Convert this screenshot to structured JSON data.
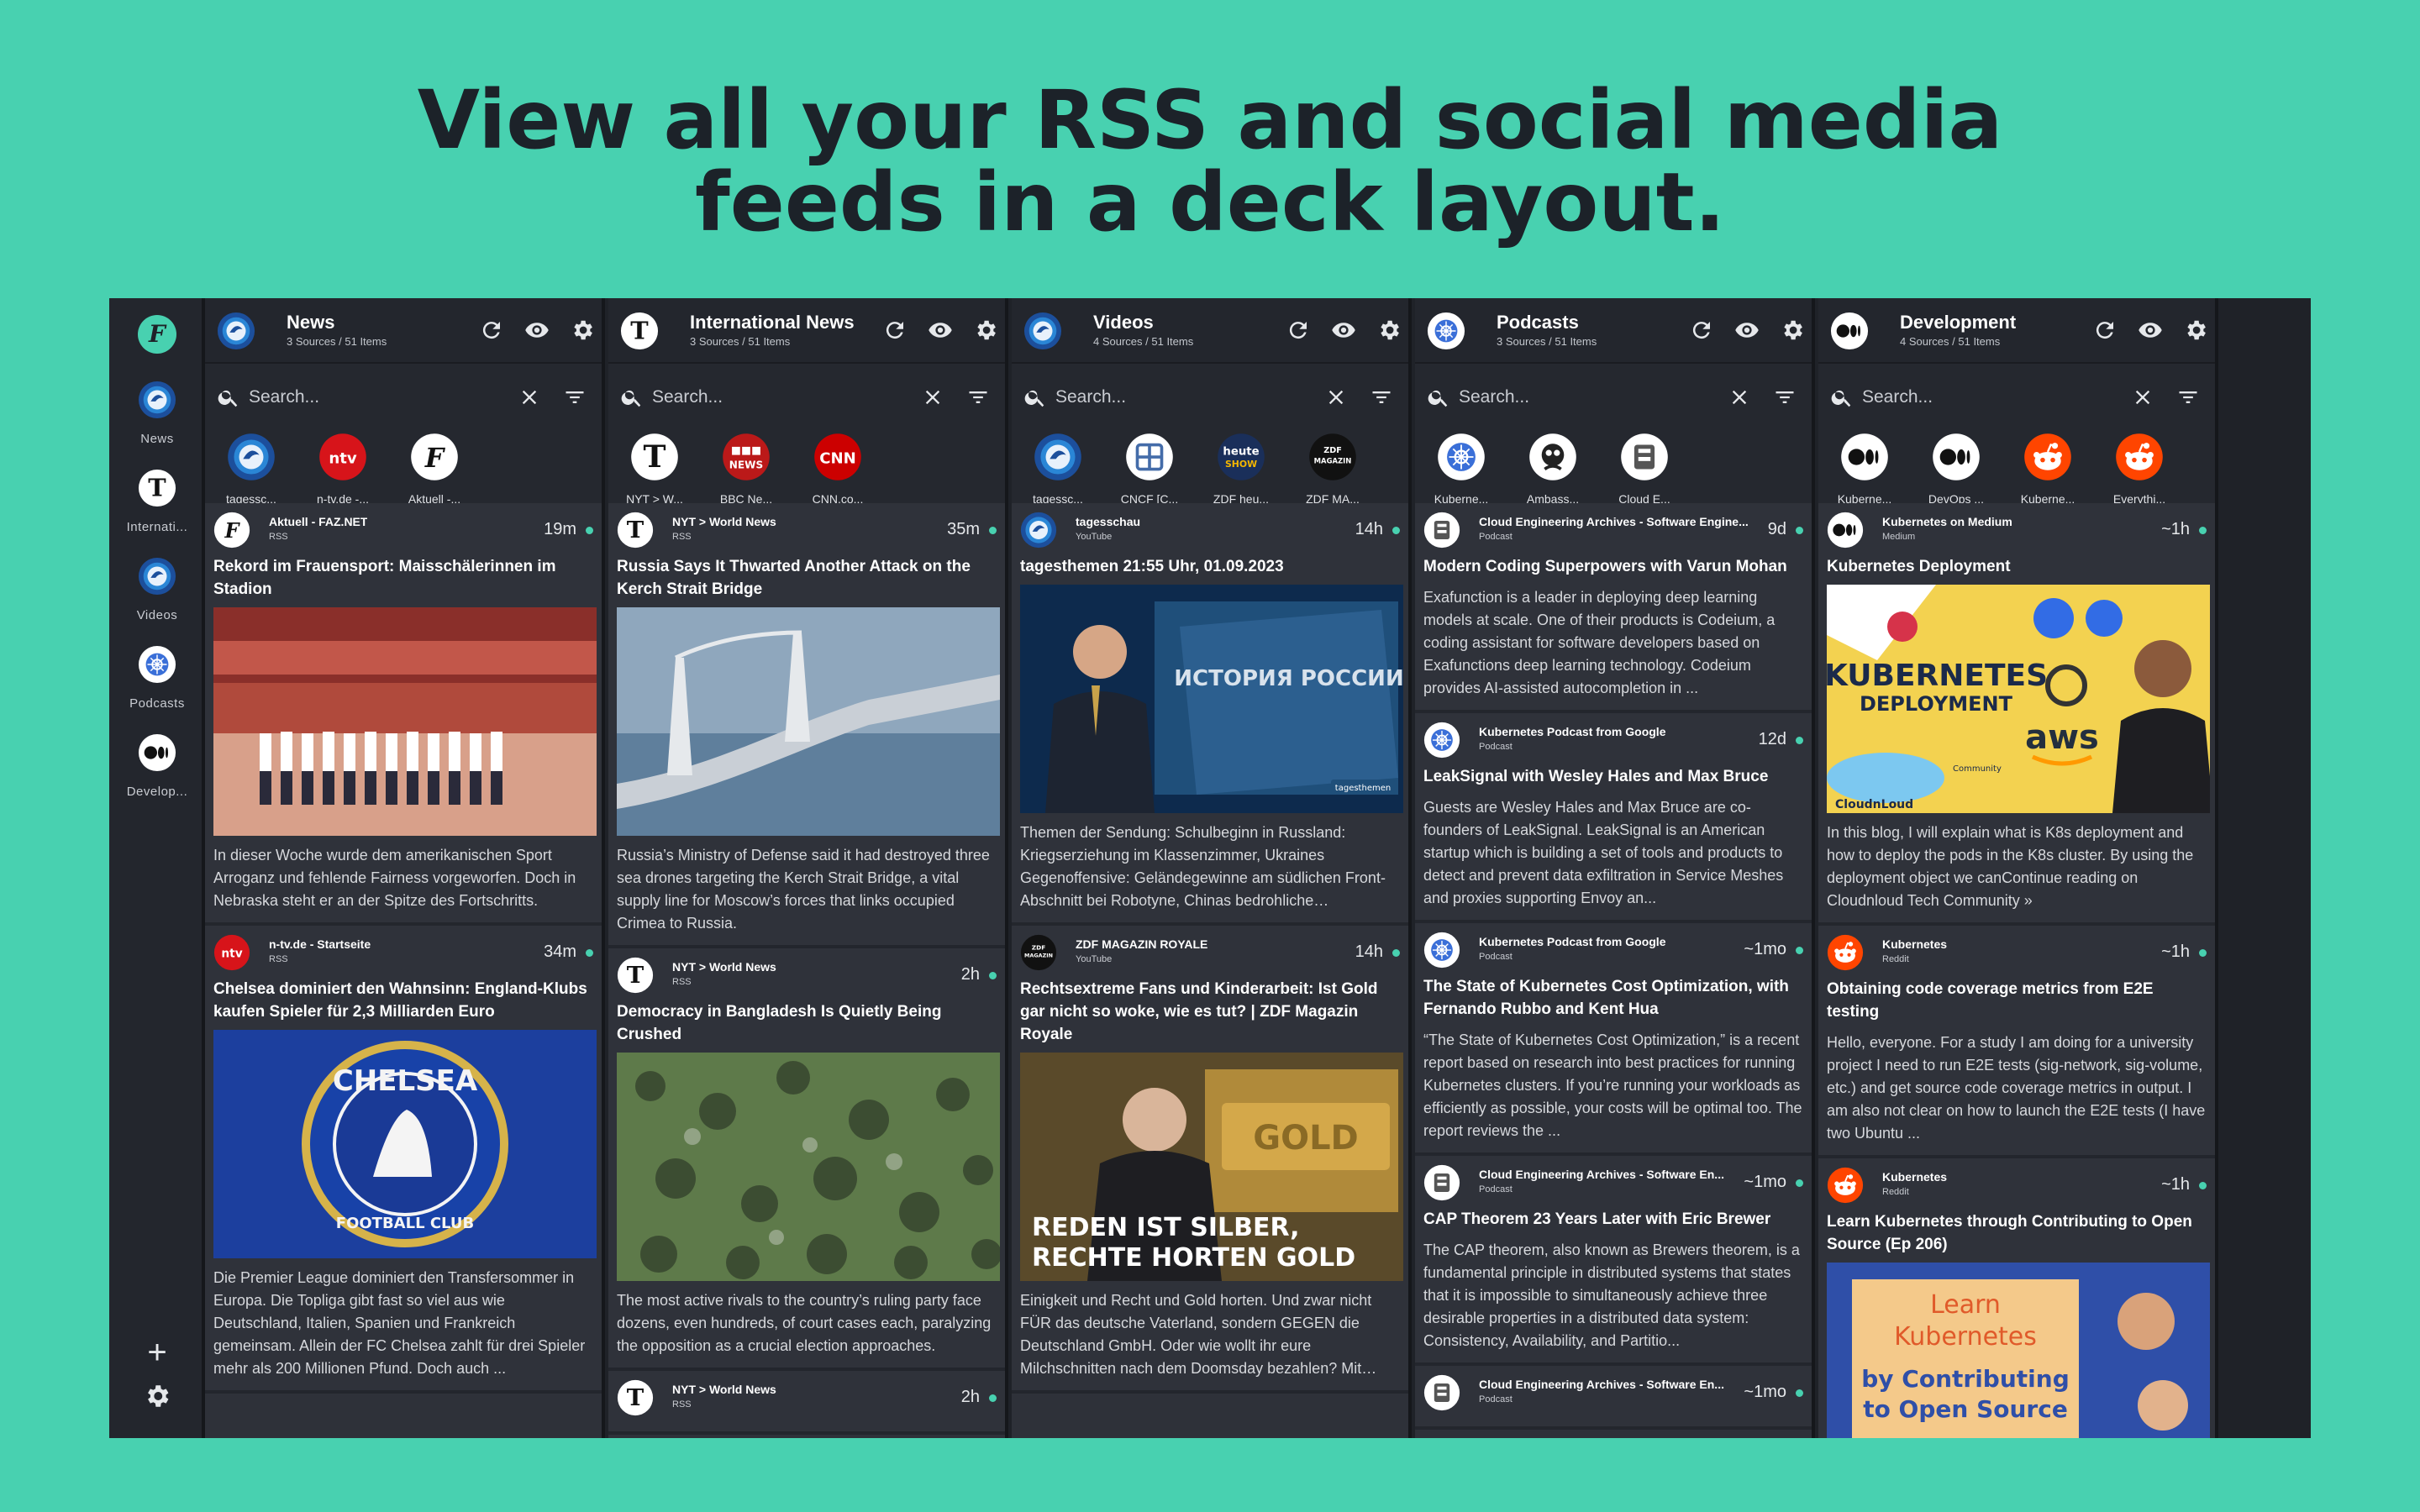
{
  "headline": {
    "line1": "View all your RSS and social media",
    "line2": "feeds in a deck layout."
  },
  "rail": {
    "items": [
      {
        "label": "News"
      },
      {
        "label": "Internati..."
      },
      {
        "label": "Videos"
      },
      {
        "label": "Podcasts"
      },
      {
        "label": "Develop..."
      }
    ]
  },
  "search_placeholder": "Search...",
  "columns": [
    {
      "title": "News",
      "subtitle": "3 Sources / 51 Items",
      "sources": [
        "tagessc...",
        "n-tv.de -...",
        "Aktuell -..."
      ],
      "items": [
        {
          "source": "Aktuell - FAZ.NET",
          "type": "RSS",
          "time": "19m",
          "title": "Rekord im Frauensport: Maisschälerinnen im Stadion",
          "body": "In dieser Woche wurde dem amerikanischen Sport Arroganz und fehlende Fairness vorgeworfen. Doch in Nebraska steht er an der Spitze des Fortschritts."
        },
        {
          "source": "n-tv.de - Startseite",
          "type": "RSS",
          "time": "34m",
          "title": "Chelsea dominiert den Wahnsinn: England-Klubs kaufen Spieler für 2,3 Milliarden Euro",
          "body": "Die Premier League dominiert den Transfersommer in Europa. Die Topliga gibt fast so viel aus wie Deutschland, Italien, Spanien und Frankreich gemeinsam. Allein der FC Chelsea zahlt für drei Spieler mehr als 200 Millionen Pfund. Doch auch ..."
        }
      ]
    },
    {
      "title": "International News",
      "subtitle": "3 Sources / 51 Items",
      "sources": [
        "NYT > W...",
        "BBC Ne...",
        "CNN.co..."
      ],
      "items": [
        {
          "source": "NYT > World News",
          "type": "RSS",
          "time": "35m",
          "title": "Russia Says It Thwarted Another Attack on the Kerch Strait Bridge",
          "body": "Russia’s Ministry of Defense said it had destroyed three sea drones targeting the Kerch Strait Bridge, a vital supply line for Moscow’s forces that links occupied Crimea to Russia."
        },
        {
          "source": "NYT > World News",
          "type": "RSS",
          "time": "2h",
          "title": "Democracy in Bangladesh Is Quietly Being Crushed",
          "body": "The most active rivals to the country’s ruling party face dozens, even hundreds, of court cases each, paralyzing the opposition as a crucial election approaches."
        },
        {
          "source": "NYT > World News",
          "type": "RSS",
          "time": "2h",
          "title": "",
          "body": ""
        }
      ]
    },
    {
      "title": "Videos",
      "subtitle": "4 Sources / 51 Items",
      "sources": [
        "tagessc...",
        "CNCF [C...",
        "ZDF heu...",
        "ZDF MA..."
      ],
      "items": [
        {
          "source": "tagesschau",
          "type": "YouTube",
          "time": "14h",
          "title": "tagesthemen 21:55 Uhr, 01.09.2023",
          "body": "Themen der Sendung: Schulbeginn in Russland: Kriegserziehung im Klassenzimmer, Ukraines Gegenoffensive: Geländegewinne am südlichen Front-Abschnitt bei Robotyne, Chinas bedrohliche Immobilienkrise, Syriens Machthaber Assad und ..."
        },
        {
          "source": "ZDF MAGAZIN ROYALE",
          "type": "YouTube",
          "time": "14h",
          "title": "Rechtsextreme Fans und Kinderarbeit: Ist Gold gar nicht so woke, wie es tut? | ZDF Magazin Royale",
          "body": "Einigkeit und Recht und Gold horten. Und zwar nicht FÜR das deutsche Vaterland, sondern GEGEN die Deutschland GmbH. Oder wie wollt ihr eure Milchschnitten nach dem Doomsday bezahlen? Mit GELD? Wie naiv seid ihr? Goldbarren bringen ..."
        }
      ]
    },
    {
      "title": "Podcasts",
      "subtitle": "3 Sources / 51 Items",
      "sources": [
        "Kuberne...",
        "Ambass...",
        "Cloud E..."
      ],
      "items": [
        {
          "source": "Cloud Engineering Archives - Software Engine...",
          "type": "Podcast",
          "time": "9d",
          "title": "Modern Coding Superpowers with Varun Mohan",
          "body": "Exafunction is a leader in deploying deep learning models at scale. One of their products is Codeium, a coding assistant for software developers based on Exafunctions deep learning technology. Codeium provides AI-assisted autocompletion in ..."
        },
        {
          "source": "Kubernetes Podcast from Google",
          "type": "Podcast",
          "time": "12d",
          "title": "LeakSignal with Wesley Hales and Max Bruce",
          "body": "Guests are Wesley Hales and Max Bruce are co-founders of LeakSignal. LeakSignal is an American startup which is building a set of tools and products to detect and prevent data exfiltration in Service Meshes and proxies supporting Envoy an..."
        },
        {
          "source": "Kubernetes Podcast from Google",
          "type": "Podcast",
          "time": "~1mo",
          "title": "The State of Kubernetes Cost Optimization, with Fernando Rubbo and Kent Hua",
          "body": "“The State of Kubernetes Cost Optimization,” is a recent report based on research into best practices for running Kubernetes clusters. If you’re running your workloads as efficiently as possible, your costs will be optimal too. The report reviews the ..."
        },
        {
          "source": "Cloud Engineering Archives - Software En...",
          "type": "Podcast",
          "time": "~1mo",
          "title": "CAP Theorem 23 Years Later with Eric Brewer",
          "body": "The CAP theorem, also known as Brewers theorem, is a fundamental principle in distributed systems that states that it is impossible to simultaneously achieve three desirable properties in a distributed data system: Consistency, Availability, and Partitio..."
        },
        {
          "source": "Cloud Engineering Archives - Software En...",
          "type": "Podcast",
          "time": "~1mo",
          "title": "",
          "body": ""
        }
      ]
    },
    {
      "title": "Development",
      "subtitle": "4 Sources / 51 Items",
      "sources": [
        "Kuberne...",
        "DevOps ...",
        "Kuberne...",
        "Everythi..."
      ],
      "items": [
        {
          "source": "Kubernetes on Medium",
          "type": "Medium",
          "time": "~1h",
          "title": "Kubernetes Deployment",
          "body": "In this blog, I will explain what is K8s deployment and how to deploy the pods in the K8s cluster. By using the deployment object we canContinue reading on Cloudnloud Tech Community »"
        },
        {
          "source": "Kubernetes",
          "type": "Reddit",
          "time": "~1h",
          "title": "Obtaining code coverage metrics from E2E testing",
          "body": "Hello, everyone. For a study I am doing for a university project I need to run E2E tests (sig-network, sig-volume, etc.) and get source code coverage metrics in output. I am also not clear on how to launch the E2E tests (I have two Ubuntu ..."
        },
        {
          "source": "Kubernetes",
          "type": "Reddit",
          "time": "~1h",
          "title": "Learn Kubernetes through Contributing to Open Source (Ep 206)",
          "body": ""
        }
      ]
    }
  ],
  "thumbs": {
    "k8s_title": "KUBERNETES",
    "k8s_sub": "DEPLOYMENT",
    "aws": "aws",
    "cloudnloud": "CloudnLoud",
    "community": "Community",
    "learn1": "Learn",
    "learn2": "Kubernetes",
    "learn3": "by Contributing",
    "learn4": "to Open Source",
    "royale_line1": "REDEN IST SILBER,",
    "royale_line2": "RECHTE HORTEN GOLD",
    "royale_gold": "GOLD",
    "chelsea_top": "CHELSEA",
    "chelsea_bottom": "FOOTBALL CLUB",
    "tagesthemen_book": "ИСТОРИЯ РОССИИ",
    "tagesthemen_badge": "tagesthemen"
  },
  "colors": {
    "accent": "#48d1b0",
    "background": "#48d1b0",
    "app_bg": "#1f2228",
    "column_bg": "#2a2d35"
  }
}
